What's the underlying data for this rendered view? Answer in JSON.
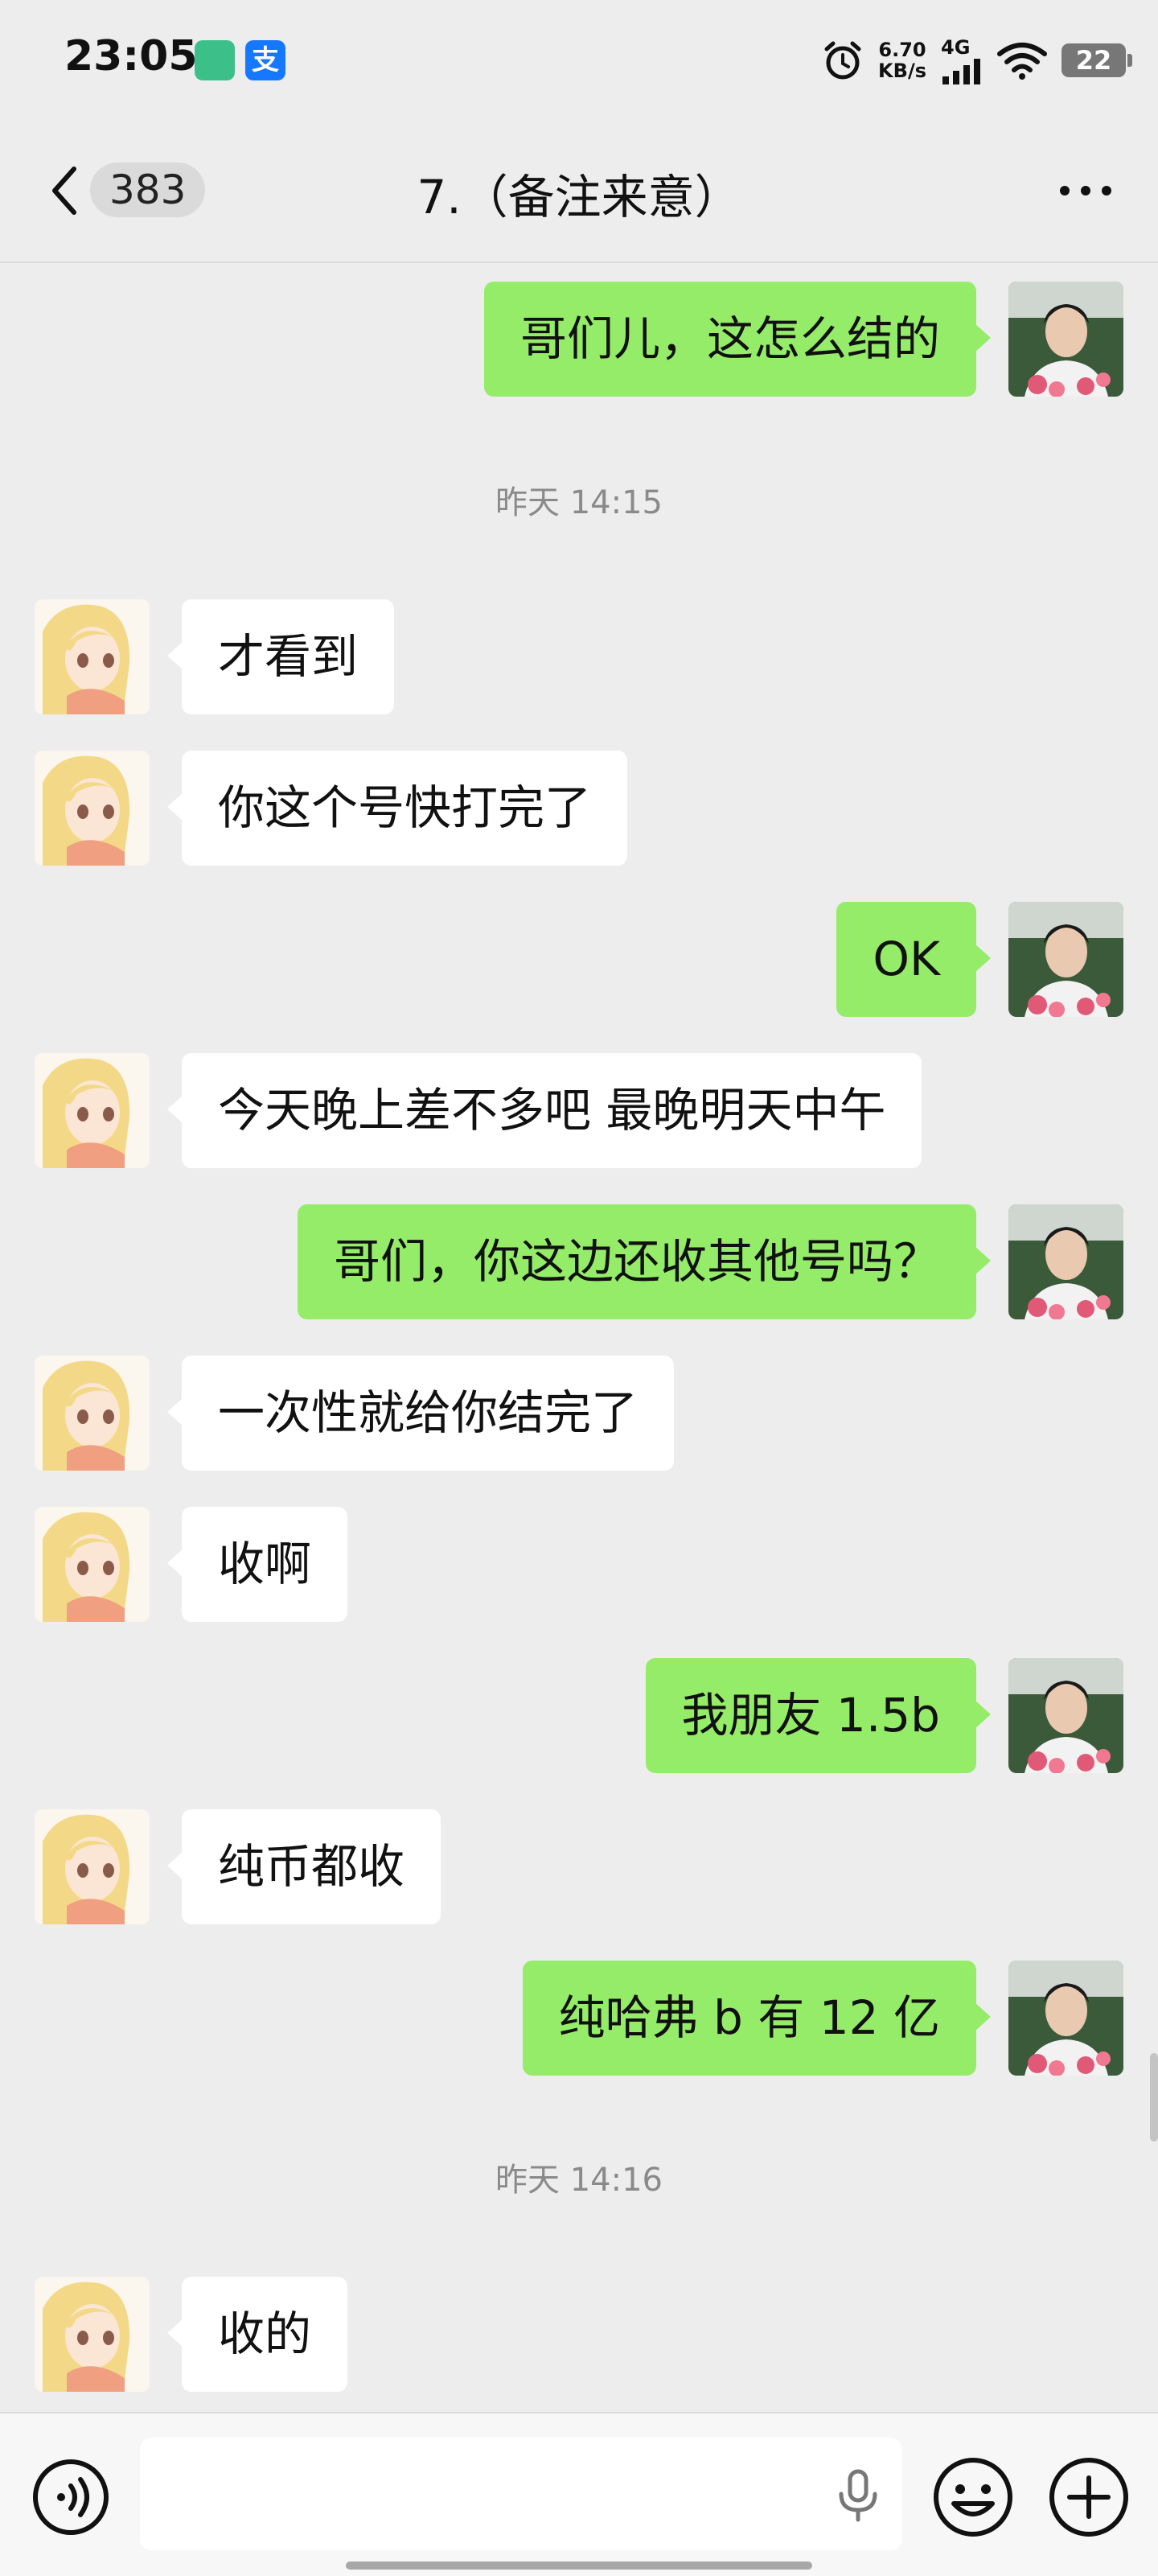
{
  "status_bar": {
    "time": "23:05",
    "net_speed_value": "6.70",
    "net_speed_unit": "KB/s",
    "network": "4G",
    "battery": "22",
    "icons": [
      "alarm-icon",
      "signal-icon",
      "wifi-icon",
      "battery-icon"
    ],
    "app_icons": [
      "app-icon",
      "alipay-icon"
    ],
    "alipay_glyph": "支"
  },
  "nav": {
    "back_icon": "chevron-left-icon",
    "unread_count": "383",
    "title": "7.（备注来意）",
    "more_icon": "more-dots-icon"
  },
  "colors": {
    "background": "#ededed",
    "outgoing_bubble": "#95ec69",
    "incoming_bubble": "#ffffff",
    "timestamp_text": "#8a8a8a"
  },
  "messages": [
    {
      "direction": "out",
      "text": "哥们儿，这怎么结的"
    },
    {
      "type": "time",
      "text": "昨天 14:15"
    },
    {
      "direction": "in",
      "text": "才看到"
    },
    {
      "direction": "in",
      "text": "你这个号快打完了"
    },
    {
      "direction": "out",
      "text": "OK"
    },
    {
      "direction": "in",
      "text": "今天晚上差不多吧 最晚明天中午"
    },
    {
      "direction": "out",
      "text": "哥们，你这边还收其他号吗？"
    },
    {
      "direction": "in",
      "text": "一次性就给你结完了"
    },
    {
      "direction": "in",
      "text": "收啊"
    },
    {
      "direction": "out",
      "text": "我朋友 1.5b"
    },
    {
      "direction": "in",
      "text": "纯币都收"
    },
    {
      "direction": "out",
      "text": "纯哈弗 b 有 12 亿"
    },
    {
      "type": "time",
      "text": "昨天 14:16"
    },
    {
      "direction": "in",
      "text": "收的"
    }
  ],
  "input_bar": {
    "voice_icon": "voice-icon",
    "input_value": "",
    "mic_icon": "microphone-icon",
    "emoji_icon": "emoji-icon",
    "plus_icon": "plus-icon"
  }
}
